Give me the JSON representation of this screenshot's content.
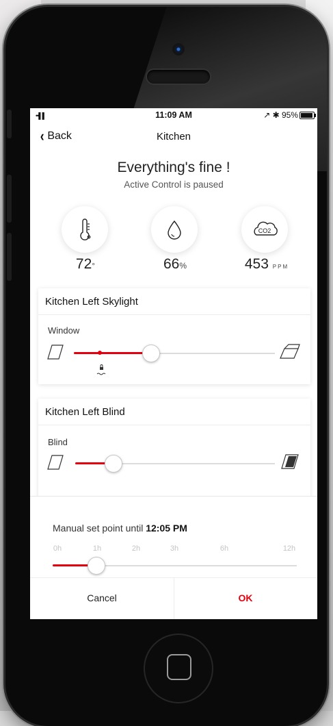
{
  "status_bar": {
    "signal": "••▌▌",
    "time": "11:09 AM",
    "right": "↗ ✱ 95%"
  },
  "nav": {
    "back_label": "Back",
    "title": "Kitchen"
  },
  "summary": {
    "headline": "Everything's fine !",
    "subtitle": "Active Control is paused"
  },
  "sensors": [
    {
      "icon": "thermometer-icon",
      "value": "72",
      "unit": "°"
    },
    {
      "icon": "humidity-drop-icon",
      "value": "66",
      "unit": "%"
    },
    {
      "icon": "co2-cloud-icon",
      "value": "453",
      "unit": "PPM",
      "icon_text": "CO2"
    }
  ],
  "devices": [
    {
      "title": "Kitchen Left Skylight",
      "label": "Window",
      "level": 0.38,
      "setpoint": 0.13,
      "icon_left": "window-closed-icon",
      "icon_right": "window-open-icon",
      "marker_icon": "rain-lock-icon"
    },
    {
      "title": "Kitchen Left Blind",
      "label": "Blind",
      "level": 0.19,
      "icon_left": "blind-open-icon",
      "icon_right": "blind-closed-icon"
    }
  ],
  "setpoint_panel": {
    "prefix": "Manual set point until ",
    "time": "12:05 PM",
    "ticks": [
      "0h",
      "1h",
      "2h",
      "3h",
      "6h",
      "12h"
    ],
    "value_label": "1h",
    "cancel_label": "Cancel",
    "ok_label": "OK"
  },
  "colors": {
    "accent": "#e3000f",
    "text": "#222222",
    "track": "#dcdcdc"
  }
}
